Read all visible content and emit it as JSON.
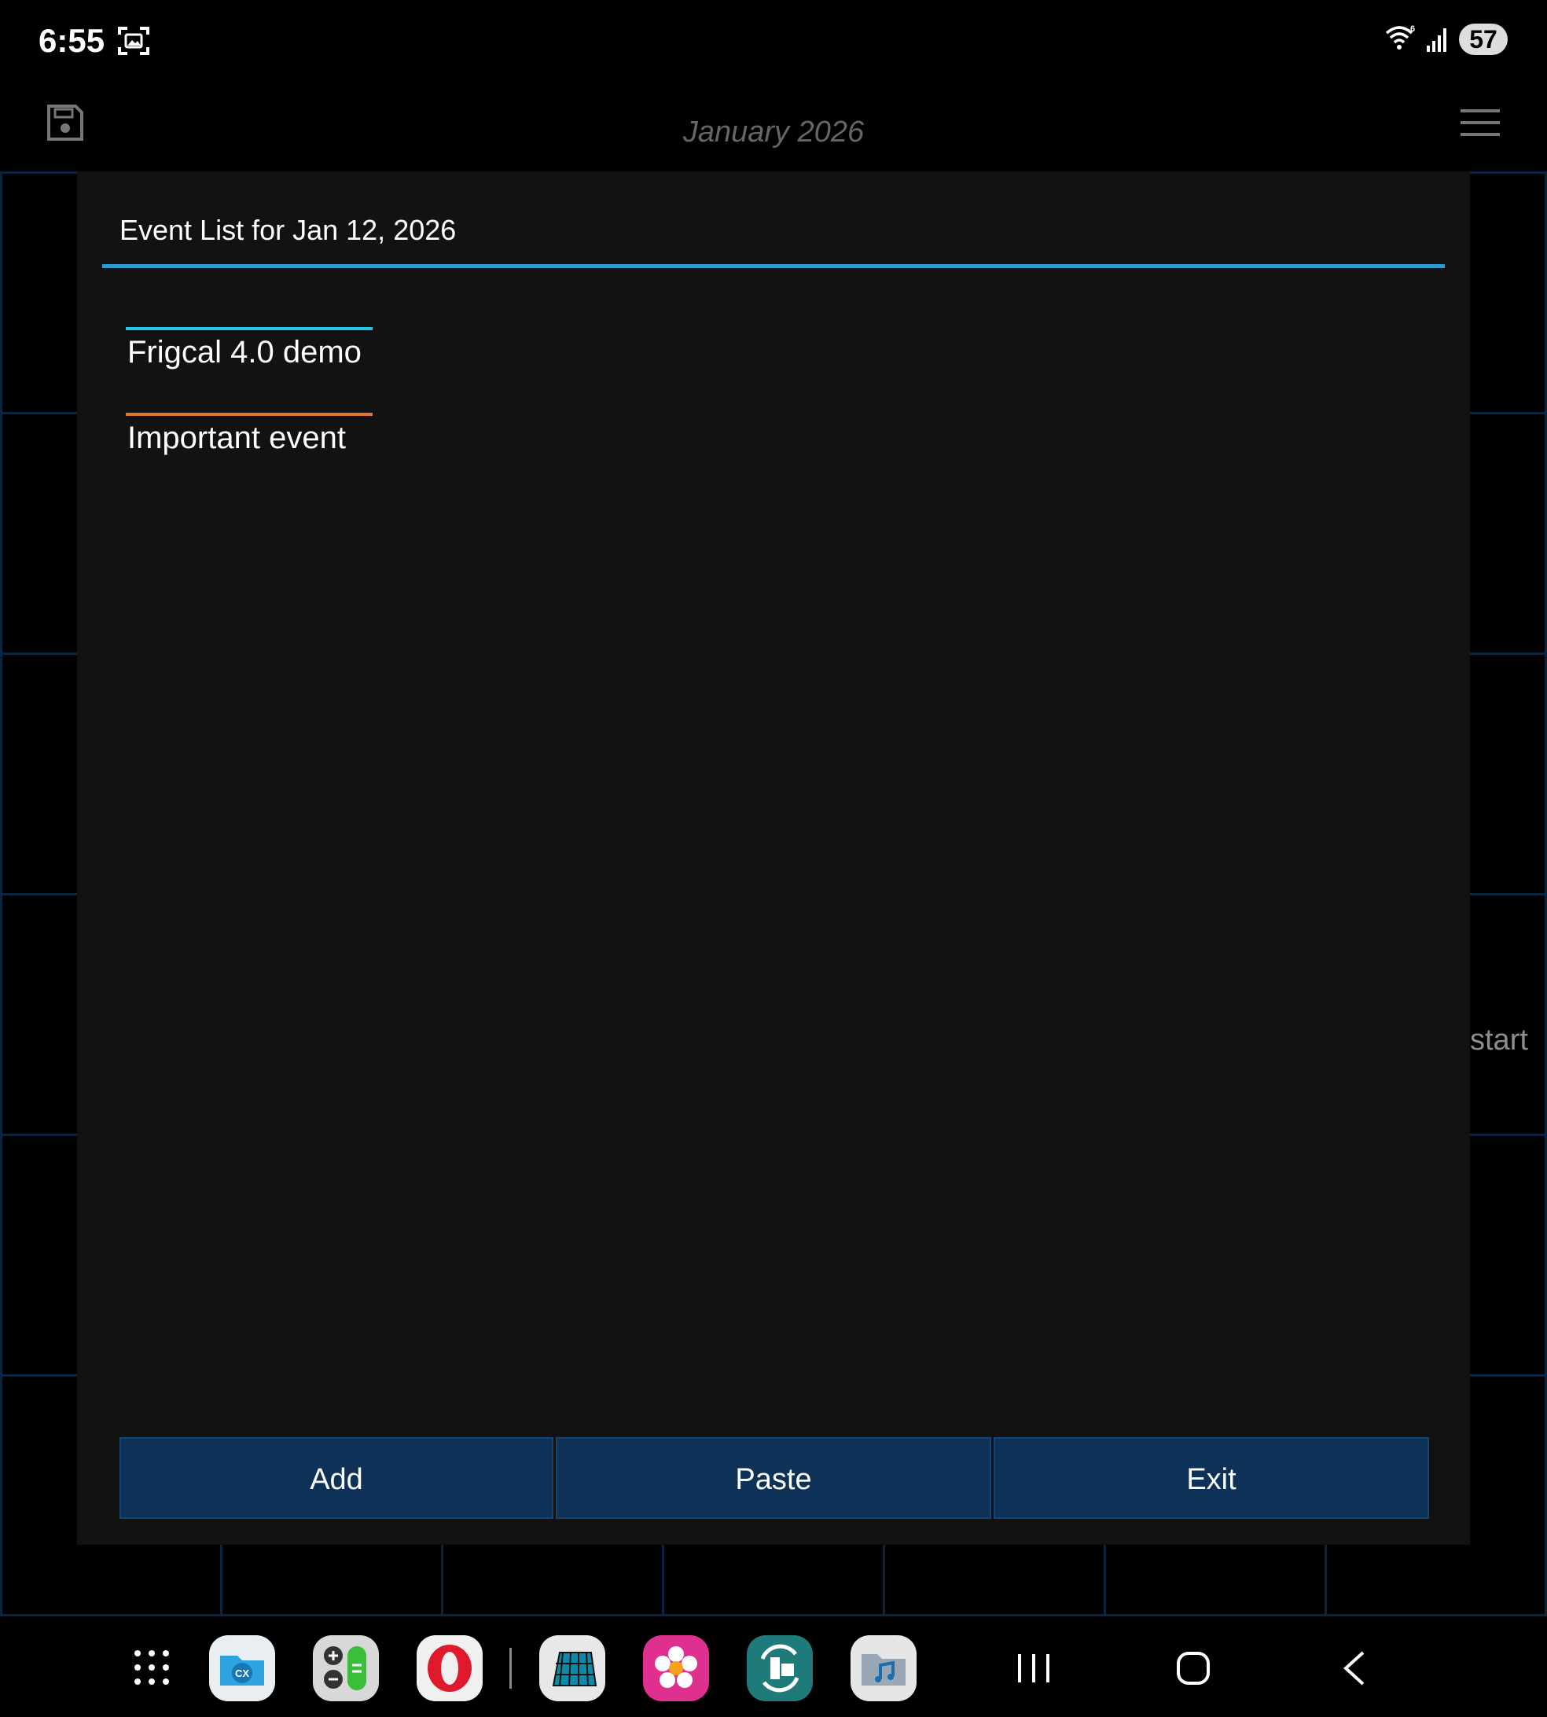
{
  "status_bar": {
    "time": "6:55",
    "battery": "57",
    "icons": [
      "screenshot-icon",
      "wifi-icon",
      "signal-icon"
    ]
  },
  "app_bar": {
    "title": "January 2026",
    "icons": [
      "save-icon",
      "menu-icon"
    ]
  },
  "calendar": {
    "visible_text": "start"
  },
  "dialog": {
    "title": "Event List for Jan 12, 2026",
    "accent_color": "#2e9bd1",
    "events": [
      {
        "label": "Frigcal 4.0 demo",
        "color": "#22c7e6"
      },
      {
        "label": "Important event",
        "color": "#e8772e"
      }
    ],
    "buttons": {
      "add": "Add",
      "paste": "Paste",
      "exit": "Exit"
    },
    "button_color": "#0d3157"
  },
  "taskbar": {
    "apps": [
      "apps-grid-icon",
      "cx-file-explorer-app-icon",
      "calculator-app-icon",
      "opera-browser-app-icon",
      "calendar-app-icon",
      "gallery-app-icon",
      "backup-sync-app-icon",
      "music-folder-app-icon"
    ],
    "nav": [
      "recents-icon",
      "home-icon",
      "back-icon"
    ]
  }
}
